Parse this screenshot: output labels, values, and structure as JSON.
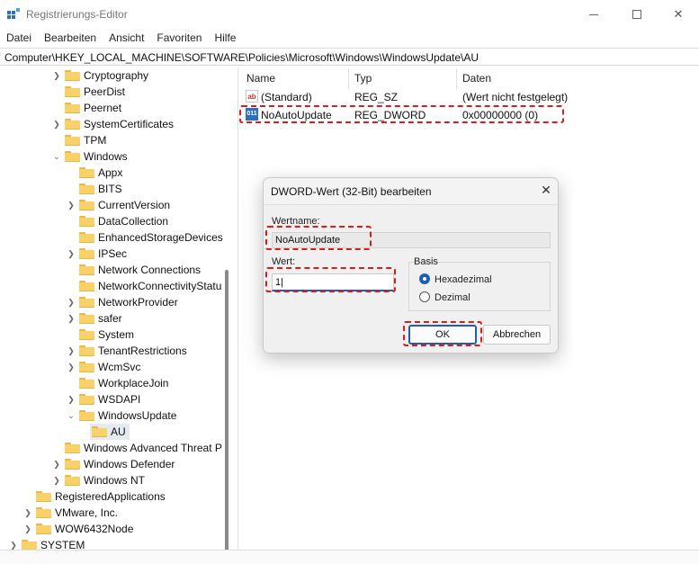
{
  "window": {
    "title": "Registrierungs-Editor",
    "menu": [
      "Datei",
      "Bearbeiten",
      "Ansicht",
      "Favoriten",
      "Hilfe"
    ],
    "address": "Computer\\HKEY_LOCAL_MACHINE\\SOFTWARE\\Policies\\Microsoft\\Windows\\WindowsUpdate\\AU"
  },
  "tree": {
    "items": [
      {
        "label": "Cryptography",
        "expander": "collapsed"
      },
      {
        "label": "PeerDist",
        "expander": "none"
      },
      {
        "label": "Peernet",
        "expander": "none"
      },
      {
        "label": "SystemCertificates",
        "expander": "collapsed"
      },
      {
        "label": "TPM",
        "expander": "none"
      },
      {
        "label": "Windows",
        "expander": "expanded"
      },
      {
        "label": "Appx",
        "expander": "none"
      },
      {
        "label": "BITS",
        "expander": "none"
      },
      {
        "label": "CurrentVersion",
        "expander": "collapsed"
      },
      {
        "label": "DataCollection",
        "expander": "none"
      },
      {
        "label": "EnhancedStorageDevices",
        "expander": "none"
      },
      {
        "label": "IPSec",
        "expander": "collapsed"
      },
      {
        "label": "Network Connections",
        "expander": "none"
      },
      {
        "label": "NetworkConnectivityStatu",
        "expander": "none"
      },
      {
        "label": "NetworkProvider",
        "expander": "collapsed"
      },
      {
        "label": "safer",
        "expander": "collapsed"
      },
      {
        "label": "System",
        "expander": "none"
      },
      {
        "label": "TenantRestrictions",
        "expander": "collapsed"
      },
      {
        "label": "WcmSvc",
        "expander": "collapsed"
      },
      {
        "label": "WorkplaceJoin",
        "expander": "none"
      },
      {
        "label": "WSDAPI",
        "expander": "collapsed"
      },
      {
        "label": "WindowsUpdate",
        "expander": "expanded"
      },
      {
        "label": "AU",
        "expander": "none",
        "selected": true
      },
      {
        "label": "Windows Advanced Threat P",
        "expander": "none"
      },
      {
        "label": "Windows Defender",
        "expander": "collapsed"
      },
      {
        "label": "Windows NT",
        "expander": "collapsed"
      },
      {
        "label": "RegisteredApplications",
        "expander": "none"
      },
      {
        "label": "VMware, Inc.",
        "expander": "collapsed"
      },
      {
        "label": "WOW6432Node",
        "expander": "collapsed"
      },
      {
        "label": "SYSTEM",
        "expander": "collapsed"
      }
    ]
  },
  "list": {
    "columns": [
      "Name",
      "Typ",
      "Daten"
    ],
    "rows": [
      {
        "icon": "string-value-icon",
        "name": "(Standard)",
        "type": "REG_SZ",
        "data": "(Wert nicht festgelegt)"
      },
      {
        "icon": "dword-value-icon",
        "name": "NoAutoUpdate",
        "type": "REG_DWORD",
        "data": "0x00000000 (0)"
      }
    ]
  },
  "dialog": {
    "title": "DWORD-Wert (32-Bit) bearbeiten",
    "name_label": "Wertname:",
    "name_value": "NoAutoUpdate",
    "value_label": "Wert:",
    "value": "1",
    "basis_label": "Basis",
    "radio_hex": "Hexadezimal",
    "radio_dec": "Dezimal",
    "selected_basis": "Hexadezimal",
    "ok": "OK",
    "cancel": "Abbrechen"
  },
  "colors": {
    "highlight_dash": "#d81d1d",
    "accent": "#1f5fb0",
    "folder": "#f7d26b"
  }
}
